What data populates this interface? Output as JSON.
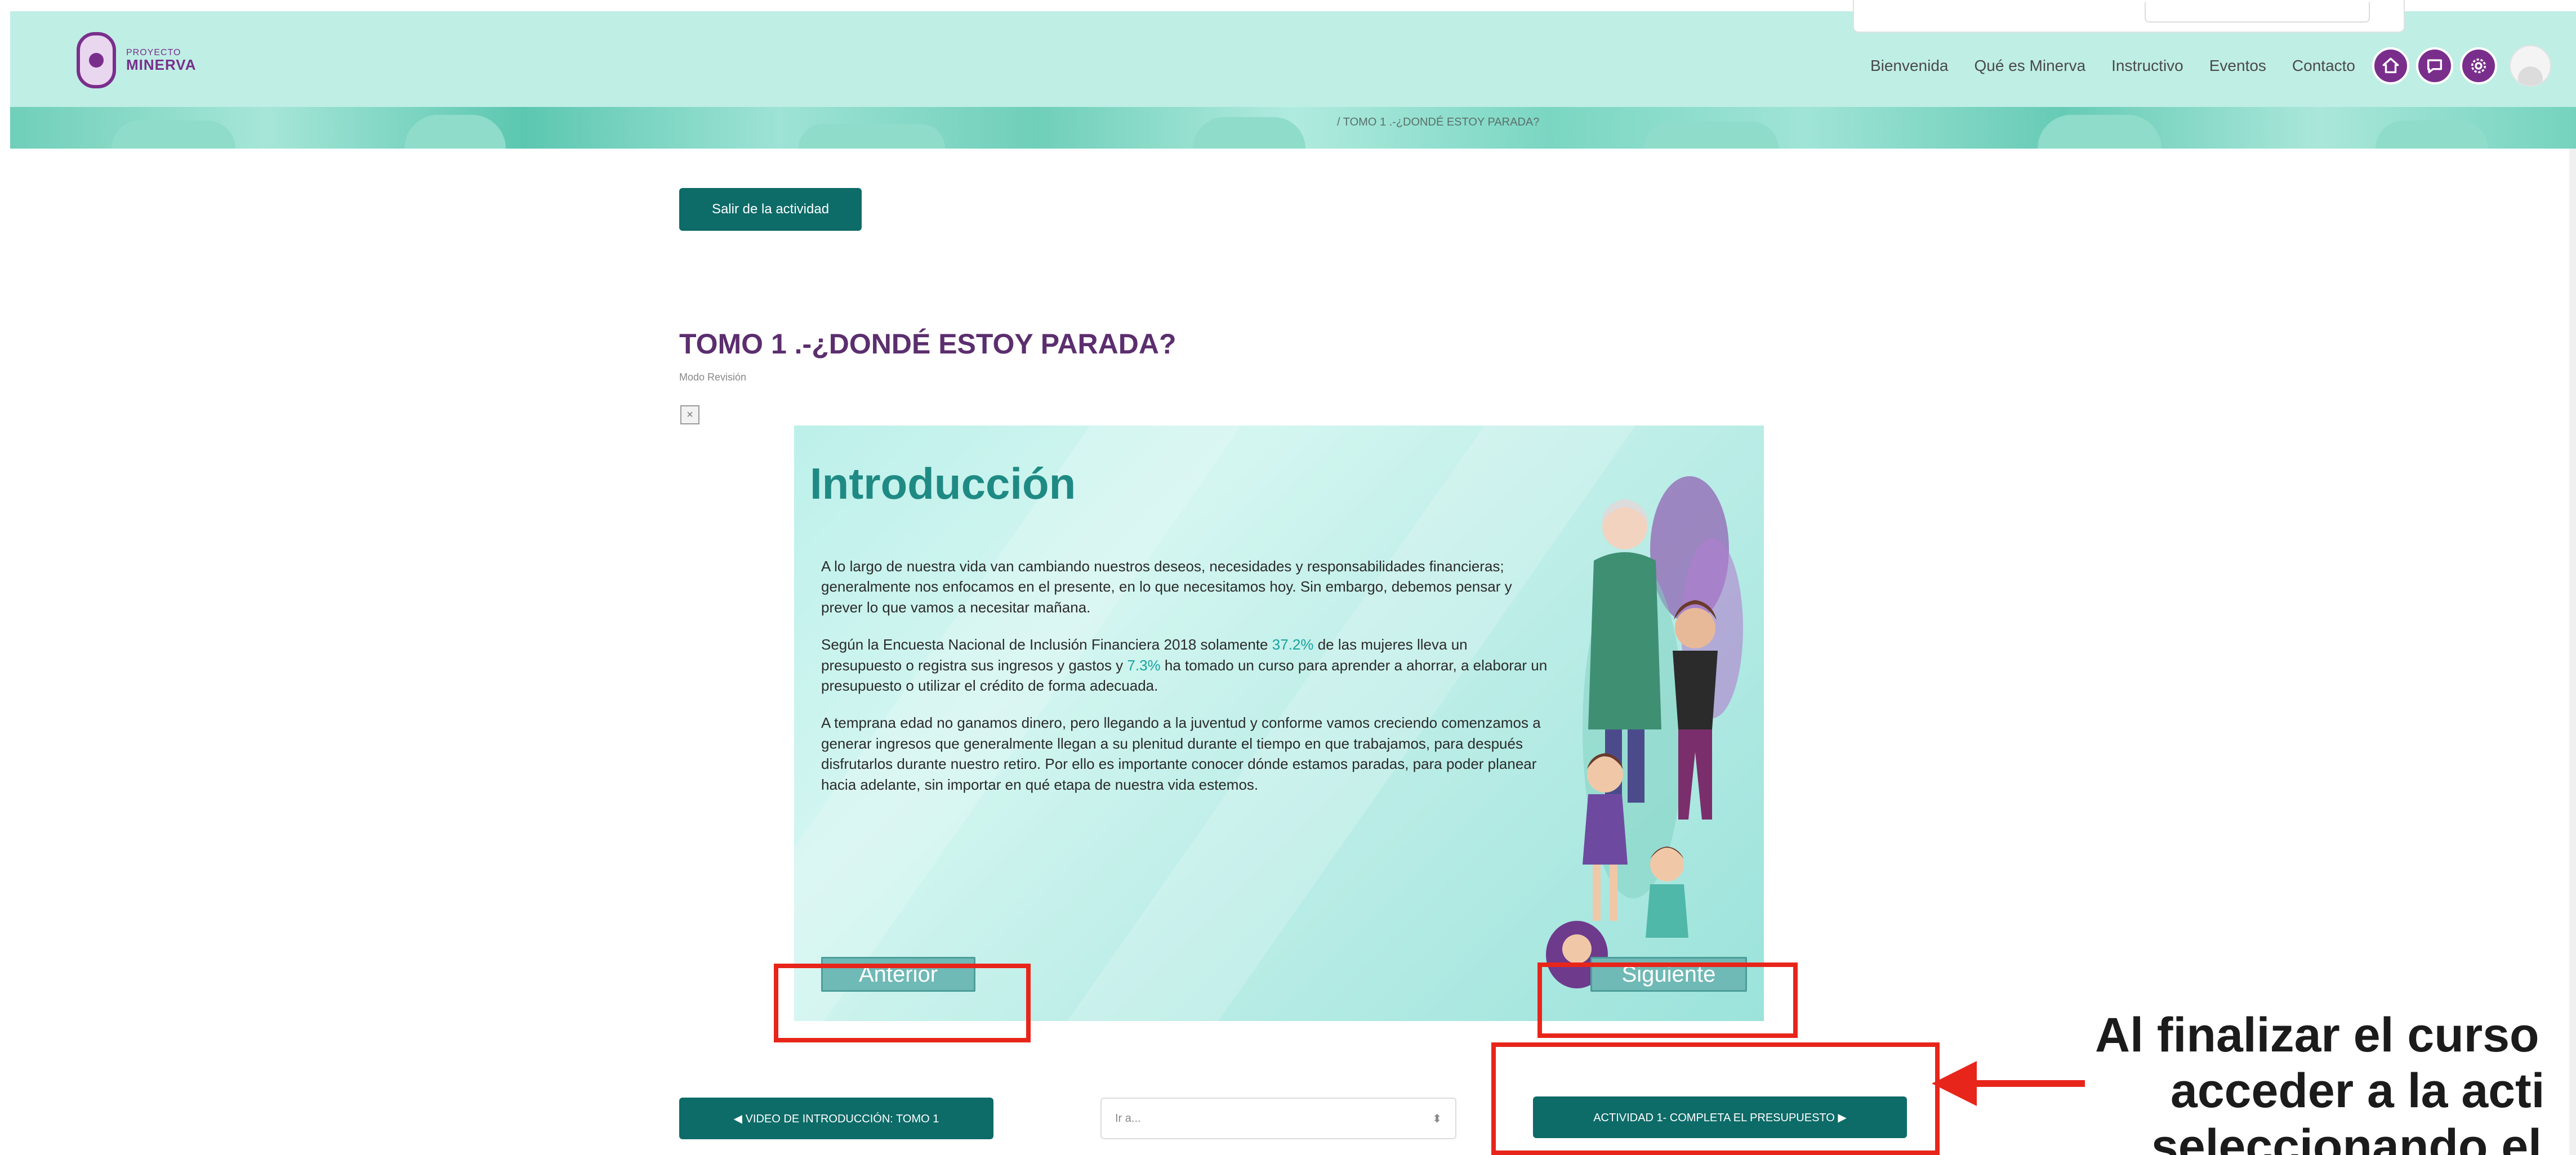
{
  "header": {
    "logo": {
      "small": "PROYECTO",
      "big": "MINERVA"
    },
    "nav": [
      "Bienvenida",
      "Qué es Minerva",
      "Instructivo",
      "Eventos",
      "Contacto"
    ],
    "icons": [
      "home-icon",
      "chat-icon",
      "settings-icon"
    ],
    "breadcrumb": "/ TOMO 1 .-¿DONDÉ ESTOY PARADA?"
  },
  "main": {
    "exit_label": "Salir de la actividad",
    "title": "TOMO 1 .-¿DONDÉ ESTOY PARADA?",
    "mode": "Modo Revisión"
  },
  "slide": {
    "title": "Introducción",
    "p1": "A lo largo de nuestra vida van cambiando nuestros deseos, necesidades y responsabilidades financieras; generalmente nos enfocamos en el presente, en lo que necesitamos hoy. Sin embargo, debemos pensar y prever lo que vamos a necesitar mañana.",
    "p2_a": "Según la Encuesta Nacional de Inclusión Financiera 2018 solamente ",
    "p2_b": "37.2%",
    "p2_c": " de las mujeres lleva un presupuesto o registra sus ingresos y gastos y ",
    "p2_d": "7.3%",
    "p2_e": " ha tomado un curso para aprender a ahorrar, a elaborar un presupuesto o utilizar el crédito de forma adecuada.",
    "p3": "A temprana edad no ganamos dinero, pero llegando a la juventud y conforme vamos creciendo comenzamos a generar ingresos que generalmente llegan a su plenitud durante el tiempo en que trabajamos, para después disfrutarlos durante nuestro retiro. Por ello es importante conocer dónde estamos paradas, para poder planear hacia adelante, sin importar en qué etapa de nuestra vida estemos.",
    "prev": "Anterior",
    "next": "Siguiente"
  },
  "activity_nav": {
    "prev": "◀ VIDEO DE INTRODUCCIÓN: TOMO 1",
    "jump_placeholder": "Ir a...",
    "jump_arrows": "⬍",
    "next": "ACTIVIDAD 1- COMPLETA EL PRESUPUESTO ▶"
  },
  "annotation": {
    "line1": "Al finalizar el curso",
    "line2": "acceder a la acti",
    "line3": "seleccionando el",
    "highlight_color": "#e8251a"
  },
  "colors": {
    "brand_purple": "#7a2e8c",
    "button_teal": "#0d6b68",
    "header_mint": "#bfeee5"
  }
}
